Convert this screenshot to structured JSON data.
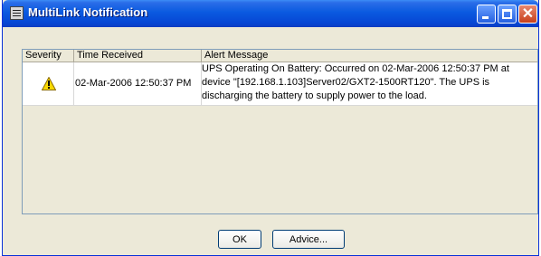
{
  "window": {
    "title": "MultiLink Notification"
  },
  "title_buttons": {
    "minimize": "minimize",
    "maximize": "maximize",
    "close": "close"
  },
  "table": {
    "columns": [
      "Severity",
      "Time Received",
      "Alert Message"
    ],
    "rows": [
      {
        "severity_icon": "warning-icon",
        "time": "02-Mar-2006 12:50:37 PM",
        "message_lines": [
          "UPS Operating On Battery: Occurred on 02-Mar-2006 12:50:37 PM at",
          "device \"[192.168.1.103]Server02/GXT2-1500RT120\". The UPS is",
          "discharging the battery to supply power to the load."
        ]
      }
    ]
  },
  "buttons": {
    "ok": "OK",
    "advice": "Advice..."
  },
  "colors": {
    "titlebar": "#0a5ae0",
    "face": "#ece9d8",
    "warning": "#f8d800"
  }
}
